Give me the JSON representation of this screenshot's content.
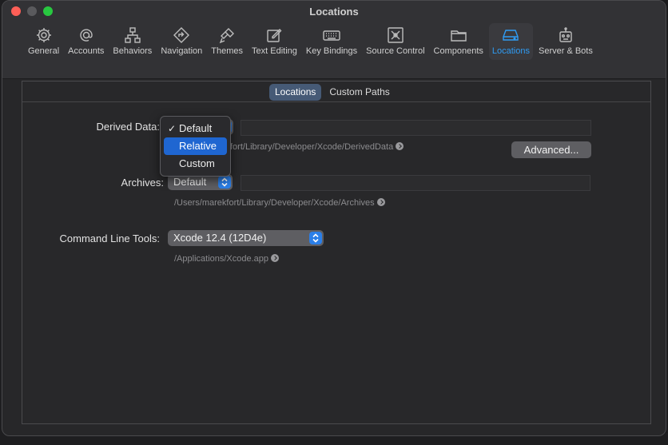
{
  "window": {
    "title": "Locations"
  },
  "toolbar": {
    "items": [
      {
        "label": "General",
        "icon": "gear-icon"
      },
      {
        "label": "Accounts",
        "icon": "at-icon"
      },
      {
        "label": "Behaviors",
        "icon": "hierarchy-icon"
      },
      {
        "label": "Navigation",
        "icon": "navigation-diamond-icon"
      },
      {
        "label": "Themes",
        "icon": "brush-icon"
      },
      {
        "label": "Text Editing",
        "icon": "pencil-square-icon"
      },
      {
        "label": "Key Bindings",
        "icon": "keyboard-icon"
      },
      {
        "label": "Source Control",
        "icon": "source-control-icon"
      },
      {
        "label": "Components",
        "icon": "folder-icon"
      },
      {
        "label": "Locations",
        "icon": "drive-icon"
      },
      {
        "label": "Server & Bots",
        "icon": "robot-icon"
      }
    ],
    "active": "Locations"
  },
  "tabs": {
    "locations": "Locations",
    "custom_paths": "Custom Paths"
  },
  "derived_data": {
    "label": "Derived Data:",
    "path": "fort/Library/Developer/Xcode/DerivedData",
    "advanced_button": "Advanced..."
  },
  "derived_menu": {
    "items": [
      "Default",
      "Relative",
      "Custom"
    ],
    "checked": "Default",
    "highlighted": "Relative"
  },
  "archives": {
    "label": "Archives:",
    "value": "Default",
    "path": "/Users/marekfort/Library/Developer/Xcode/Archives"
  },
  "command_line_tools": {
    "label": "Command Line Tools:",
    "value": "Xcode 12.4 (12D4e)",
    "path": "/Applications/Xcode.app"
  },
  "colors": {
    "accent": "#2f9cf4",
    "highlight": "#1f66d1",
    "popup_arrow": "#2b7fe8"
  }
}
